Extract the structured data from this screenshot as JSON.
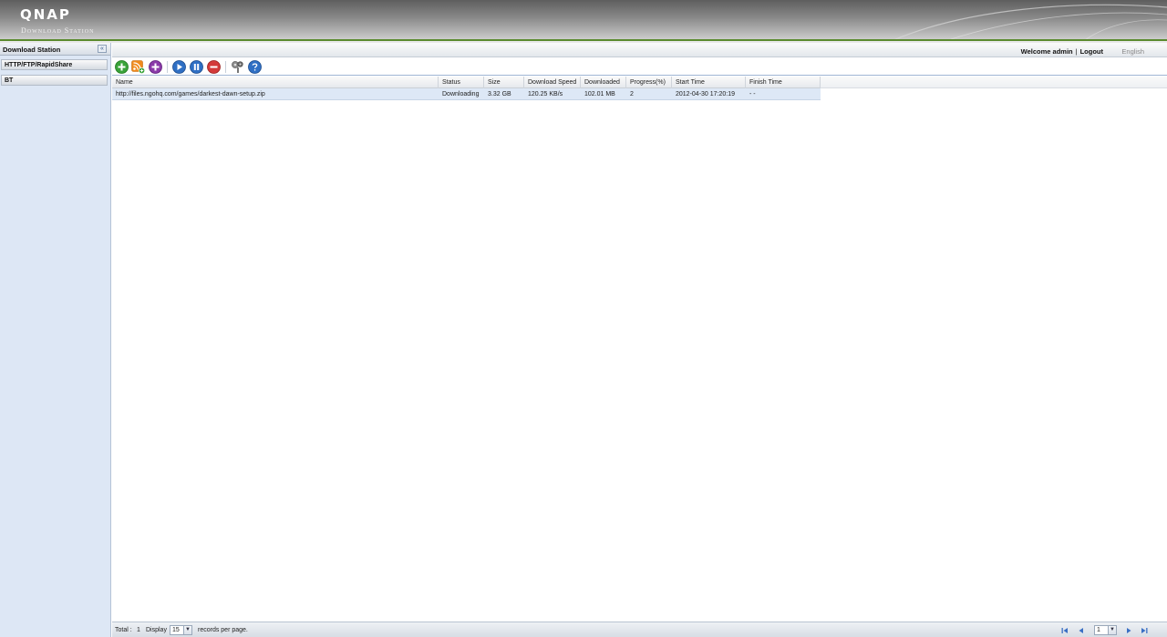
{
  "header": {
    "logo": "QNAP",
    "product": "Download Station"
  },
  "sidebar": {
    "title": "Download Station",
    "collapse_icon": "«",
    "items": [
      {
        "label": "HTTP/FTP/RapidShare"
      },
      {
        "label": "BT"
      }
    ]
  },
  "topbar": {
    "welcome": "Welcome admin",
    "separator": "|",
    "logout": "Logout",
    "language": "English"
  },
  "toolbar": {
    "buttons": [
      {
        "name": "add-icon",
        "color": "#3aa33a"
      },
      {
        "name": "rss-icon",
        "color": "#f08a1c"
      },
      {
        "name": "add-purple-icon",
        "color": "#8a3aa8"
      },
      {
        "name": "play-icon",
        "color": "#2f6fc4"
      },
      {
        "name": "pause-icon",
        "color": "#2f6fc4"
      },
      {
        "name": "remove-icon",
        "color": "#d33a3a"
      },
      {
        "name": "settings-icon",
        "color": "#6a6a6a"
      },
      {
        "name": "help-icon",
        "color": "#2f6fc4"
      }
    ]
  },
  "grid": {
    "columns": [
      "Name",
      "Status",
      "Size",
      "Download Speed",
      "Downloaded",
      "Progress(%)",
      "Start Time",
      "Finish Time"
    ],
    "rows": [
      {
        "name": "http://files.ngohq.com/games/darkest-dawn-setup.zip",
        "status": "Downloading",
        "size": "3.32 GB",
        "speed": "120.25 KB/s",
        "downloaded": "102.01 MB",
        "progress": "2",
        "start": "2012-04-30 17:20:19",
        "finish": "- -"
      }
    ]
  },
  "footer": {
    "total_label": "Total :",
    "total_value": "1",
    "display_label": "Display",
    "page_size": "15",
    "records_label": "records per page.",
    "page_number": "1"
  },
  "colors": {
    "accent_green": "#5a8a2e",
    "sidebar_bg": "#dde7f5",
    "selected_row": "#dde8f6"
  }
}
